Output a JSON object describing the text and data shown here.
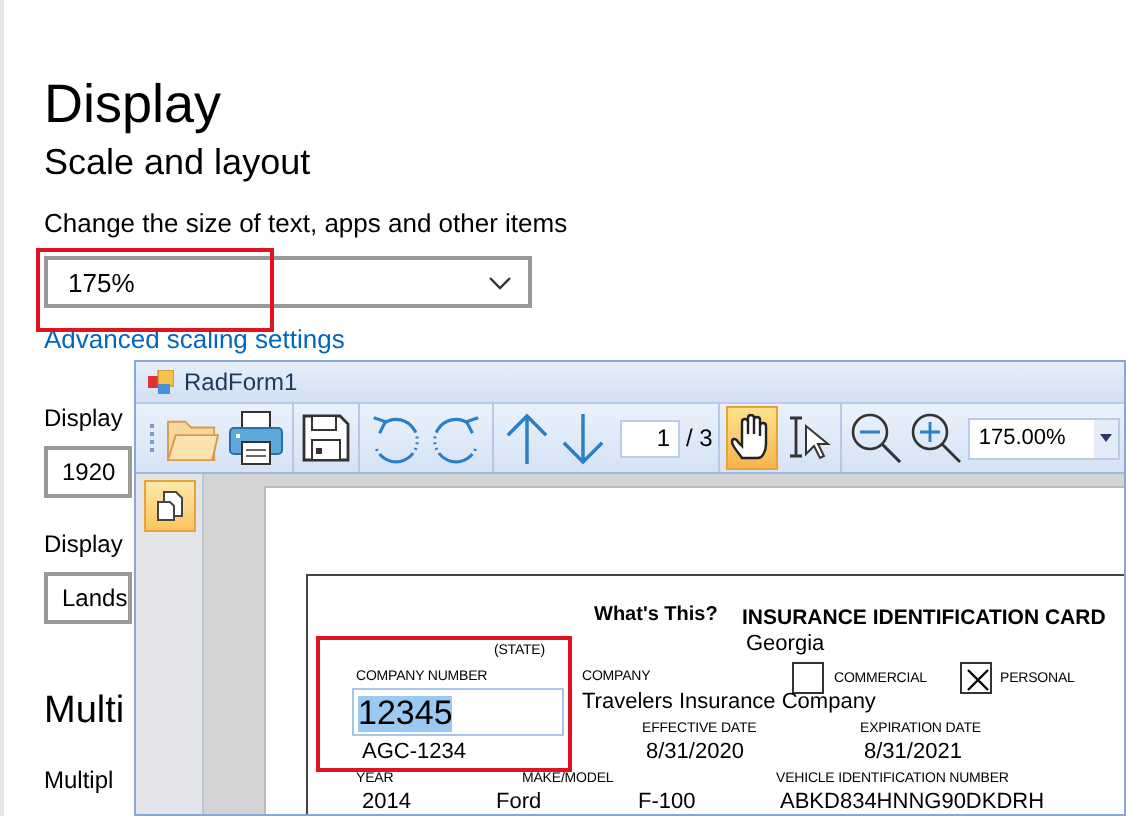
{
  "settings": {
    "title": "Display",
    "section": "Scale and layout",
    "scale_label": "Change the size of text, apps and other items",
    "scale_value": "175%",
    "advanced_link": "Advanced scaling settings",
    "resolution_label": "Display",
    "resolution_value": "1920",
    "orientation_label": "Display",
    "orientation_value": "Lands",
    "multi_heading": "Multi",
    "multi_label": "Multipl"
  },
  "window": {
    "title": "RadForm1",
    "toolbar_groups": [
      {
        "tools": [
          {
            "kind": "grip"
          },
          {
            "kind": "open"
          },
          {
            "kind": "print"
          }
        ]
      },
      {
        "tools": [
          {
            "kind": "save"
          }
        ]
      },
      {
        "tools": [
          {
            "kind": "undo"
          },
          {
            "kind": "redo"
          }
        ]
      },
      {
        "tools": [
          {
            "kind": "up"
          },
          {
            "kind": "down"
          },
          {
            "kind": "pager",
            "value": "1",
            "total": "/ 3"
          }
        ]
      },
      {
        "tools": [
          {
            "kind": "hand",
            "selected": true
          },
          {
            "kind": "select",
            "selected": false
          }
        ]
      },
      {
        "tools": [
          {
            "kind": "zoom_out"
          },
          {
            "kind": "zoom_in"
          },
          {
            "kind": "zoom_select",
            "value": "175.00%"
          }
        ]
      }
    ],
    "side_buttons": [
      {
        "kind": "thumbnails",
        "selected": true
      }
    ]
  },
  "card": {
    "whats_this": "What's This?",
    "title": "INSURANCE IDENTIFICATION CARD",
    "state_label": "(STATE)",
    "state": "Georgia",
    "company_number_label": "COMPANY NUMBER",
    "company_number": "12345",
    "company_label": "COMPANY",
    "company": "Travelers Insurance Company",
    "checkboxes": [
      {
        "label": "COMMERCIAL",
        "checked": false
      },
      {
        "label": "PERSONAL",
        "checked": true
      }
    ],
    "effective_date_label": "EFFECTIVE DATE",
    "expiration_date_label": "EXPIRATION DATE",
    "policy_number": "AGC-1234",
    "effective_date": "8/31/2020",
    "expiration_date": "8/31/2021",
    "year_label": "YEAR",
    "make_model_label": "MAKE/MODEL",
    "vin_label": "VEHICLE IDENTIFICATION NUMBER",
    "year": "2014",
    "make": "Ford",
    "model": "F-100",
    "vin": "ABKD834HNNG90DKDRH"
  }
}
